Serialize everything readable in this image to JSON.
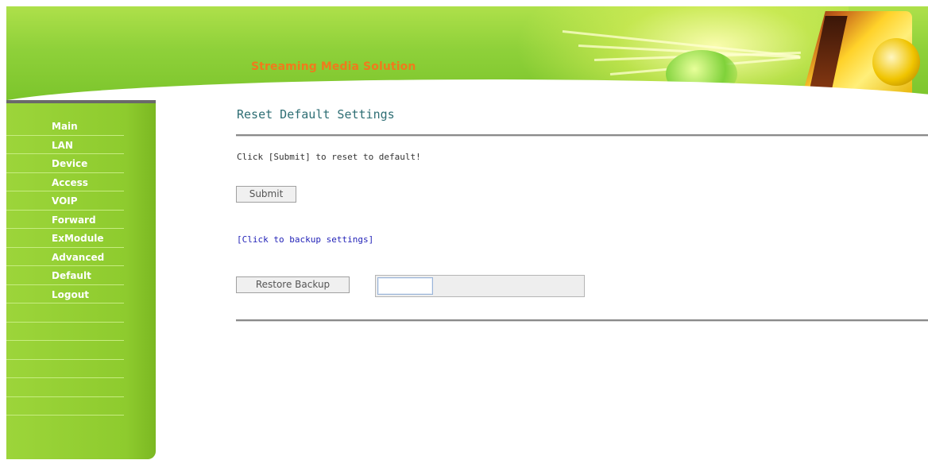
{
  "header": {
    "brand_title": "Streaming Media Solution",
    "brand_color": "#f07a1c",
    "banner_color": "#8fd13a"
  },
  "sidebar": {
    "items": [
      {
        "label": "Main"
      },
      {
        "label": "LAN"
      },
      {
        "label": "Device"
      },
      {
        "label": "Access"
      },
      {
        "label": "VOIP"
      },
      {
        "label": "Forward"
      },
      {
        "label": "ExModule"
      },
      {
        "label": "Advanced"
      },
      {
        "label": "Default"
      },
      {
        "label": "Logout"
      }
    ],
    "color": "#9cd53a"
  },
  "main": {
    "title": "Reset Default Settings",
    "instruction": "Click [Submit] to reset to default!",
    "submit_label": "Submit",
    "backup_link": "[Click to backup settings]",
    "restore_label": "Restore Backup",
    "link_color": "#2323b8",
    "title_color": "#2e6e74"
  }
}
